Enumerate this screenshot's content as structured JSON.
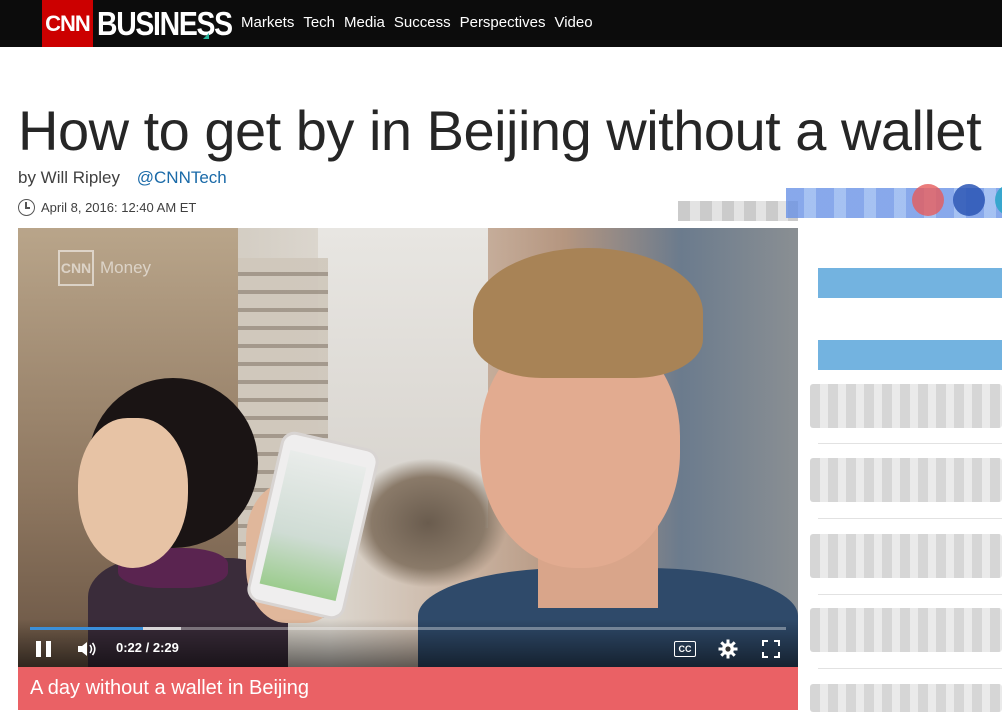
{
  "nav": {
    "logo_text": "CNN",
    "brand": "BUSINESS",
    "links": [
      "Markets",
      "Tech",
      "Media",
      "Success",
      "Perspectives",
      "Video"
    ]
  },
  "article": {
    "headline": "How to get by in Beijing without a wallet",
    "author": "by Will Ripley",
    "twitter": "@CNNTech",
    "timestamp": "April 8, 2016: 12:40 AM ET"
  },
  "video": {
    "watermark_logo": "CNN",
    "watermark_text": "Money",
    "time_display": "0:22 / 2:29",
    "progress_played": 0.15,
    "progress_buffered": 0.2,
    "cc_label": "CC",
    "caption": "A day without a wallet in Beijing"
  },
  "colors": {
    "nav_bg": "#0c0c0c",
    "cnn_red": "#cc0000",
    "caption_bg": "#ea6165",
    "twitter_link": "#1a6aa8",
    "progress": "#3a8fd9"
  }
}
